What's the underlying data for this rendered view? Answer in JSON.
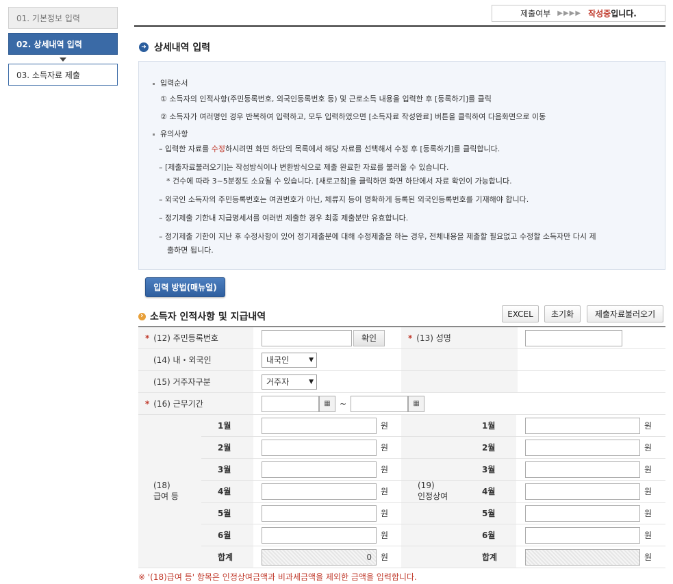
{
  "sidebar": {
    "steps": [
      {
        "label": "01. 기본정보 입력"
      },
      {
        "label": "02. 상세내역 입력"
      },
      {
        "label": "03. 소득자료 제출"
      }
    ]
  },
  "status": {
    "label": "제출여부",
    "arrows": "▶▶▶▶",
    "state": "작성중",
    "suffix": "입니다."
  },
  "section_title": "상세내역 입력",
  "info": {
    "order_title": "입력순서",
    "order_1": "① 소득자의 인적사항(주민등록번호, 외국인등록번호 등) 및 근로소득 내용을 입력한 후 [등록하기]를 클릭",
    "order_2": "② 소득자가 여러명인 경우 반복하여 입력하고, 모두 입력하였으면 [소득자료 작성완료] 버튼을 클릭하여 다음화면으로 이동",
    "notice_title": "유의사항",
    "n1_pre": "– 입력한 자료를 ",
    "n1_red": "수정",
    "n1_post": "하시려면 화면 하단의 목록에서 해당 자료를 선택해서 수정 후 [등록하기]를 클릭합니다.",
    "n2": "– [제출자료불러오기]는 작성방식이나 변환방식으로 제출 완료한 자료를 불러올 수 있습니다.",
    "n2_sub": "* 건수에 따라 3~5분정도 소요될 수 있습니다. [새로고침]을 클릭하면 화면 하단에서 자료 확인이 가능합니다.",
    "n3": "– 외국인 소득자의 주민등록번호는 여권번호가 아닌, 체류지 등이 명확하게 등록된 외국인등록번호를 기재해야 합니다.",
    "n4": "– 정기제출 기한내 지급명세서를 여러번 제출한 경우 최종 제출분만 유효합니다.",
    "n5": "– 정기제출 기한이 지난 후 수정사항이 있어 정기제출분에 대해 수정제출을 하는 경우, 전체내용을 제출할 필요없고 수정할 소득자만 다시 제",
    "n5_cont": "출하면 됩니다."
  },
  "manual_button": "입력 방법(매뉴얼)",
  "sub_title": "소득자 인적사항 및 지급내역",
  "toolbar": {
    "excel": "EXCEL",
    "reset": "초기화",
    "load": "제출자료불러오기"
  },
  "form": {
    "star": "*",
    "rrn_label": "(12) 주민등록번호",
    "confirm": "확인",
    "name_label": "(13) 성명",
    "nationality_label": "(14) 내・외국인",
    "nationality_value": "내국인",
    "residence_label": "(15) 거주자구분",
    "residence_value": "거주자",
    "period_label": "(16) 근무기간",
    "tilde": "~",
    "salary_label_1": "(18)",
    "salary_label_2": "급여 등",
    "bonus_label_1": "(19)",
    "bonus_label_2": "인정상여",
    "months": [
      "1월",
      "2월",
      "3월",
      "4월",
      "5월",
      "6월"
    ],
    "total": "합계",
    "unit": "원",
    "salary_total": "0"
  },
  "note": "※ '(18)급여 등' 항목은 인정상여금액과 비과세금액을 제외한 금액을 입력합니다."
}
